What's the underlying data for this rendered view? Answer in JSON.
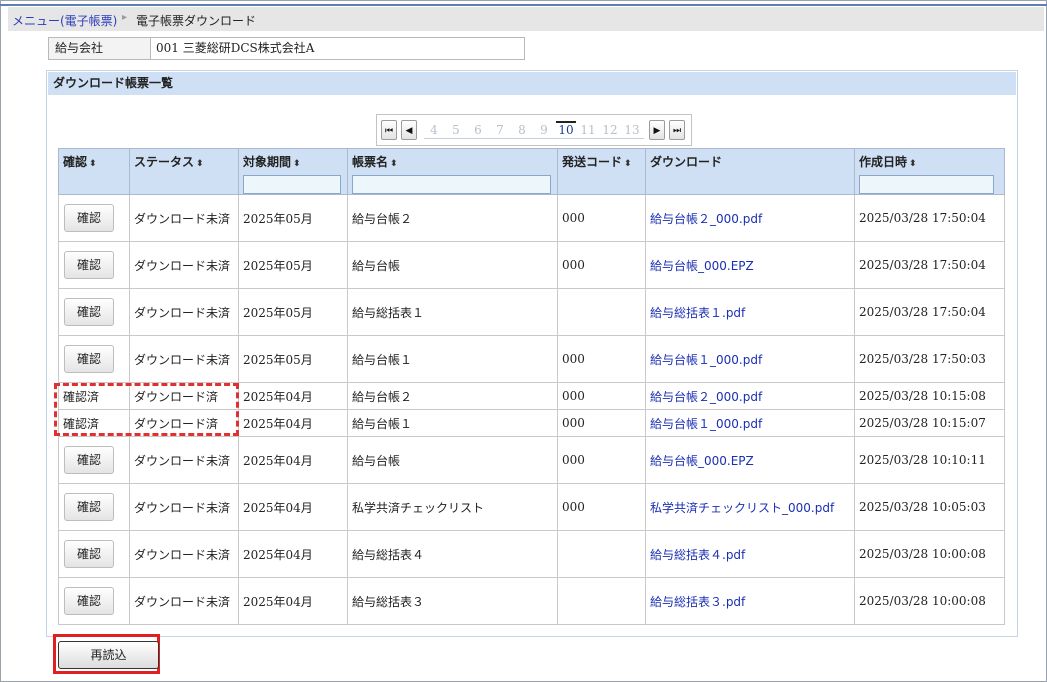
{
  "breadcrumb": {
    "parent": "メニュー(電子帳票)",
    "separator": "▸",
    "current": "電子帳票ダウンロード"
  },
  "company": {
    "label": "給与会社",
    "value": "001 三菱総研DCS株式会社A"
  },
  "panel": {
    "title": "ダウンロード帳票一覧"
  },
  "pager": {
    "first": "⏮",
    "prev": "◀",
    "next": "▶",
    "last": "⏭",
    "pages": [
      "4",
      "5",
      "6",
      "7",
      "8",
      "9",
      "10",
      "11",
      "12",
      "13"
    ],
    "current": "10"
  },
  "table": {
    "sort_icon": "⬍",
    "headers": {
      "confirm": "確認",
      "status": "ステータス",
      "period": "対象期間",
      "name": "帳票名",
      "code": "発送コード",
      "download": "ダウンロード",
      "created": "作成日時"
    },
    "confirm_button_label": "確認",
    "rows": [
      {
        "confirmed": false,
        "confirm": "確認",
        "status": "ダウンロード未済",
        "period": "2025年05月",
        "name": "給与台帳２",
        "code": "000",
        "file": "給与台帳２_000.pdf",
        "created": "2025/03/28 17:50:04"
      },
      {
        "confirmed": false,
        "confirm": "確認",
        "status": "ダウンロード未済",
        "period": "2025年05月",
        "name": "給与台帳",
        "code": "000",
        "file": "給与台帳_000.EPZ",
        "created": "2025/03/28 17:50:04"
      },
      {
        "confirmed": false,
        "confirm": "確認",
        "status": "ダウンロード未済",
        "period": "2025年05月",
        "name": "給与総括表１",
        "code": "",
        "file": "給与総括表１.pdf",
        "created": "2025/03/28 17:50:04"
      },
      {
        "confirmed": false,
        "confirm": "確認",
        "status": "ダウンロード未済",
        "period": "2025年05月",
        "name": "給与台帳１",
        "code": "000",
        "file": "給与台帳１_000.pdf",
        "created": "2025/03/28 17:50:03"
      },
      {
        "confirmed": true,
        "confirm": "確認済",
        "status": "ダウンロード済",
        "period": "2025年04月",
        "name": "給与台帳２",
        "code": "000",
        "file": "給与台帳２_000.pdf",
        "created": "2025/03/28 10:15:08"
      },
      {
        "confirmed": true,
        "confirm": "確認済",
        "status": "ダウンロード済",
        "period": "2025年04月",
        "name": "給与台帳１",
        "code": "000",
        "file": "給与台帳１_000.pdf",
        "created": "2025/03/28 10:15:07"
      },
      {
        "confirmed": false,
        "confirm": "確認",
        "status": "ダウンロード未済",
        "period": "2025年04月",
        "name": "給与台帳",
        "code": "000",
        "file": "給与台帳_000.EPZ",
        "created": "2025/03/28 10:10:11"
      },
      {
        "confirmed": false,
        "confirm": "確認",
        "status": "ダウンロード未済",
        "period": "2025年04月",
        "name": "私学共済チェックリスト",
        "code": "000",
        "file": "私学共済チェックリスト_000.pdf",
        "created": "2025/03/28 10:05:03"
      },
      {
        "confirmed": false,
        "confirm": "確認",
        "status": "ダウンロード未済",
        "period": "2025年04月",
        "name": "給与総括表４",
        "code": "",
        "file": "給与総括表４.pdf",
        "created": "2025/03/28 10:00:08"
      },
      {
        "confirmed": false,
        "confirm": "確認",
        "status": "ダウンロード未済",
        "period": "2025年04月",
        "name": "給与総括表３",
        "code": "",
        "file": "給与総括表３.pdf",
        "created": "2025/03/28 10:00:08"
      }
    ]
  },
  "reload_button": "再読込",
  "colors": {
    "accent": "#5b7fb6",
    "header_bg": "#cfe0f5",
    "link": "#1a2fb3",
    "highlight": "#e02020"
  }
}
